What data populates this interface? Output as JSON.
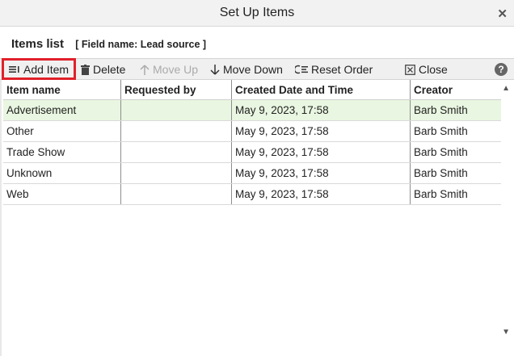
{
  "window": {
    "title": "Set Up Items"
  },
  "header": {
    "items_title": "Items list",
    "field_name": "[ Field name: Lead source ]"
  },
  "toolbar": {
    "add_item": "Add Item",
    "delete": "Delete",
    "move_up": "Move Up",
    "move_down": "Move Down",
    "reset_order": "Reset Order",
    "close": "Close",
    "help": "?"
  },
  "table": {
    "columns": [
      "Item name",
      "Requested by",
      "Created Date and Time",
      "Creator"
    ],
    "rows": [
      {
        "name": "Advertisement",
        "requested_by": "",
        "created": "May 9, 2023, 17:58",
        "creator": "Barb Smith",
        "selected": true
      },
      {
        "name": "Other",
        "requested_by": "",
        "created": "May 9, 2023, 17:58",
        "creator": "Barb Smith",
        "selected": false
      },
      {
        "name": "Trade Show",
        "requested_by": "",
        "created": "May 9, 2023, 17:58",
        "creator": "Barb Smith",
        "selected": false
      },
      {
        "name": "Unknown",
        "requested_by": "",
        "created": "May 9, 2023, 17:58",
        "creator": "Barb Smith",
        "selected": false
      },
      {
        "name": "Web",
        "requested_by": "",
        "created": "May 9, 2023, 17:58",
        "creator": "Barb Smith",
        "selected": false
      }
    ]
  },
  "colors": {
    "highlight": "#e0202a",
    "selected_row": "#e9f6e1"
  }
}
